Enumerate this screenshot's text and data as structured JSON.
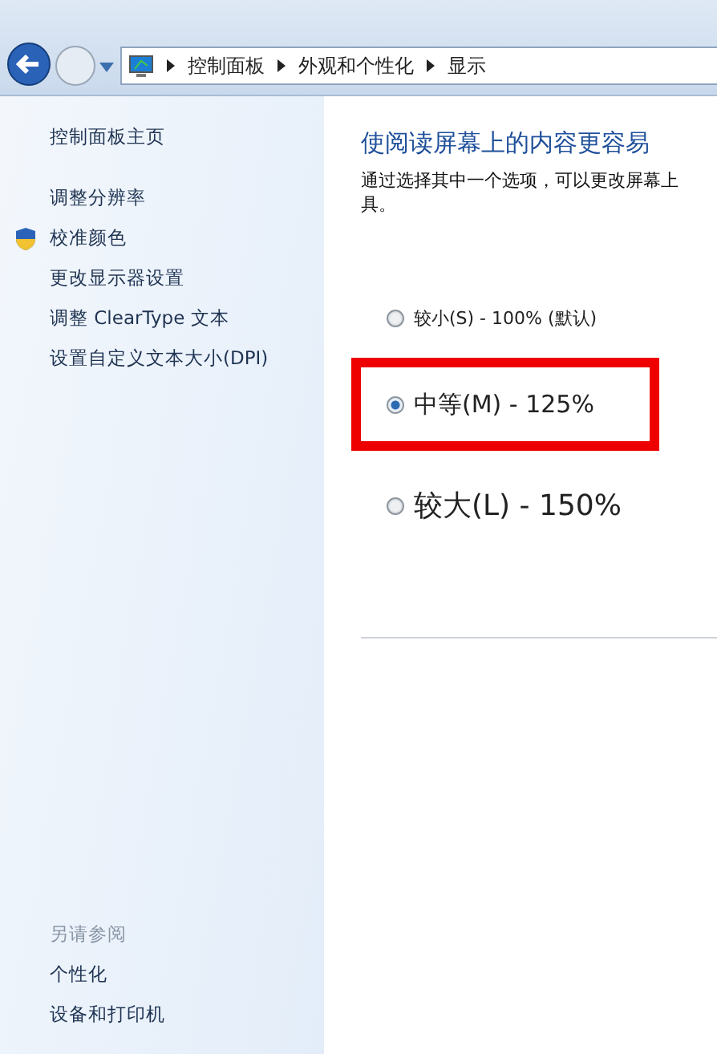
{
  "breadcrumb": [
    "控制面板",
    "外观和个性化",
    "显示"
  ],
  "sidebar": {
    "home": "控制面板主页",
    "items": [
      {
        "label": "调整分辨率",
        "kind": "link"
      },
      {
        "label": "校准颜色",
        "kind": "shield"
      },
      {
        "label": "更改显示器设置",
        "kind": "link"
      },
      {
        "label": "调整 ClearType 文本",
        "kind": "link"
      },
      {
        "label": "设置自定义文本大小(DPI)",
        "kind": "link"
      }
    ],
    "see_also": {
      "heading": "另请参阅",
      "items": [
        "个性化",
        "设备和打印机"
      ]
    }
  },
  "main": {
    "title": "使阅读屏幕上的内容更容易",
    "description_lines": [
      "通过选择其中一个选项，可以更改屏幕上",
      "具。"
    ],
    "options": [
      {
        "label": "较小(S) - 100% (默认)",
        "kind": "small",
        "selected": false,
        "highlighted": false
      },
      {
        "label": "中等(M) - 125%",
        "kind": "medium",
        "selected": true,
        "highlighted": true
      },
      {
        "label": "较大(L) - 150%",
        "kind": "large",
        "selected": false,
        "highlighted": false
      }
    ]
  }
}
